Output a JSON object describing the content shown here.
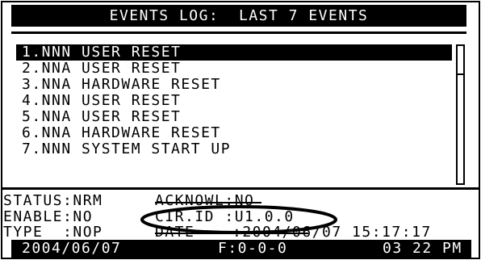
{
  "title": "EVENTS LOG:  LAST 7 EVENTS",
  "events": [
    {
      "label": "1.NNN USER RESET",
      "selected": true
    },
    {
      "label": "2.NNA USER RESET",
      "selected": false
    },
    {
      "label": "3.NNA HARDWARE RESET",
      "selected": false
    },
    {
      "label": "4.NNN USER RESET",
      "selected": false
    },
    {
      "label": "5.NNA USER RESET",
      "selected": false
    },
    {
      "label": "6.NNA HARDWARE RESET",
      "selected": false
    },
    {
      "label": "7.NNN SYSTEM START UP",
      "selected": false
    }
  ],
  "details": {
    "status": "STATUS:NRM",
    "acknowledge": "ACKNOWL:NO",
    "enable": "ENABLE:NO",
    "cir_id": "CIR.ID :U1.0.0",
    "type": "TYPE  :NOP",
    "date_label": "DATE",
    "date_value": ":2004/06/07 15:17:17"
  },
  "footer": {
    "date": "2004/06/07",
    "f_value": "F:0-0-0",
    "time": "03 22 PM"
  }
}
